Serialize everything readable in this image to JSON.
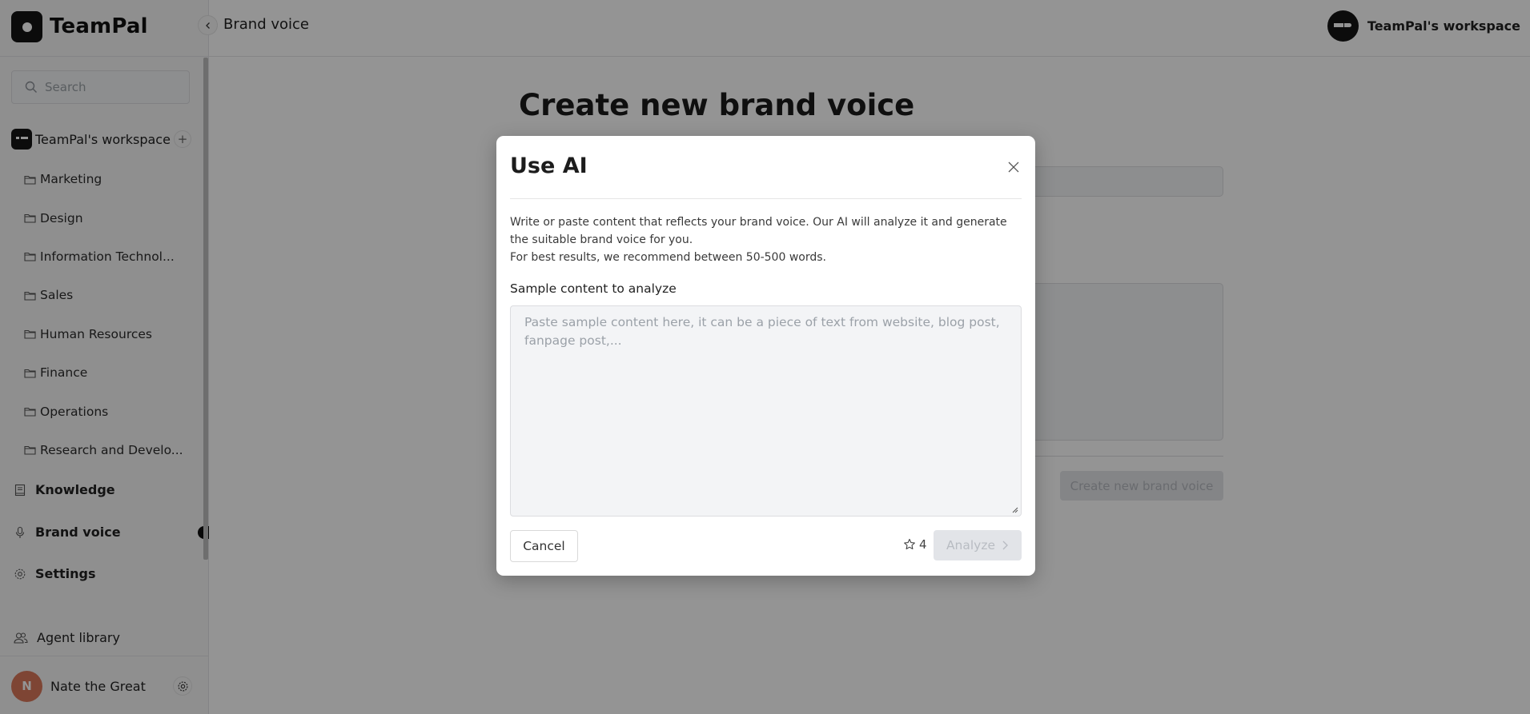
{
  "app": {
    "name": "TeamPal"
  },
  "header": {
    "breadcrumb": "Brand voice",
    "workspace_name": "TeamPal's workspace"
  },
  "sidebar": {
    "search_placeholder": "Search",
    "workspace": {
      "name": "TeamPal's workspace",
      "add_icon": "plus-icon"
    },
    "folders": [
      {
        "label": "Marketing",
        "icon": "folder-icon"
      },
      {
        "label": "Design",
        "icon": "folder-icon"
      },
      {
        "label": "Information Technol...",
        "icon": "folder-icon"
      },
      {
        "label": "Sales",
        "icon": "folder-icon"
      },
      {
        "label": "Human Resources",
        "icon": "folder-icon"
      },
      {
        "label": "Finance",
        "icon": "folder-icon"
      },
      {
        "label": "Operations",
        "icon": "folder-icon"
      },
      {
        "label": "Research and Develo...",
        "icon": "folder-icon"
      }
    ],
    "nav": [
      {
        "label": "Knowledge",
        "icon": "book-icon"
      },
      {
        "label": "Brand voice",
        "icon": "microphone-icon",
        "active": true
      },
      {
        "label": "Settings",
        "icon": "gear-icon"
      },
      {
        "label": "Agent library",
        "icon": "users-icon"
      }
    ],
    "user": {
      "initial": "N",
      "name": "Nate the Great",
      "avatar_color": "#d9785b"
    }
  },
  "main": {
    "page_title": "Create new brand voice",
    "create_button_label": "Create new brand voice"
  },
  "modal": {
    "title": "Use AI",
    "description_line1": "Write or paste content that reflects your brand voice. Our AI will analyze it and generate the suitable brand voice for you.",
    "description_line2": "For best results, we recommend between 50-500 words.",
    "field_label": "Sample content to analyze",
    "textarea_value": "",
    "textarea_placeholder": "Paste sample content here, it can be a piece of text from website, blog post, fanpage post,...",
    "cancel_label": "Cancel",
    "credits": "4",
    "analyze_label": "Analyze",
    "analyze_disabled": true
  }
}
